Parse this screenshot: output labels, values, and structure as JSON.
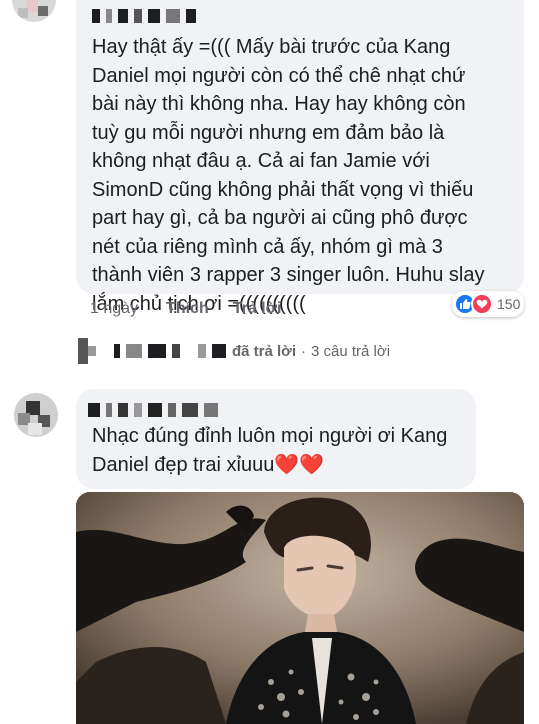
{
  "comment1": {
    "text": "Hay thật ấy =((( Mấy bài trước của Kang\nDaniel mọi người còn có thể chê nhạt chứ\nbài này thì không nha. Hay hay không còn\ntuỳ gu mỗi người nhưng em đảm bảo là\nkhông nhạt đâu ạ. Cả ai fan Jamie với\nSimonD cũng không phải thất vọng vì thiếu\npart hay gì, cả ba người ai cũng phô được\nnét của riêng mình cả ấy, nhóm gì mà 3\nthành viên 3 rapper 3 singer luôn. Huhu slay\nlắm chủ tịch ơi =((((((((((",
    "time": "1 ngày",
    "like_label": "Thích",
    "reply_label": "Trả lời",
    "reaction_count": "150",
    "reactions": [
      "like-icon",
      "love-icon"
    ]
  },
  "reply_summary": {
    "action": "đã trả lời",
    "separator": "·",
    "count_text": "3 câu trả lời"
  },
  "comment2": {
    "text": "Nhạc đúng đỉnh luôn mọi người ơi Kang\nDaniel đẹp trai xỉuuu",
    "emoji": "❤️❤️"
  },
  "colors": {
    "bubble": "#f0f2f5",
    "text": "#1c1e21",
    "meta": "#65676b",
    "like_blue": "#1877f2",
    "love_red": "#f33e58"
  }
}
